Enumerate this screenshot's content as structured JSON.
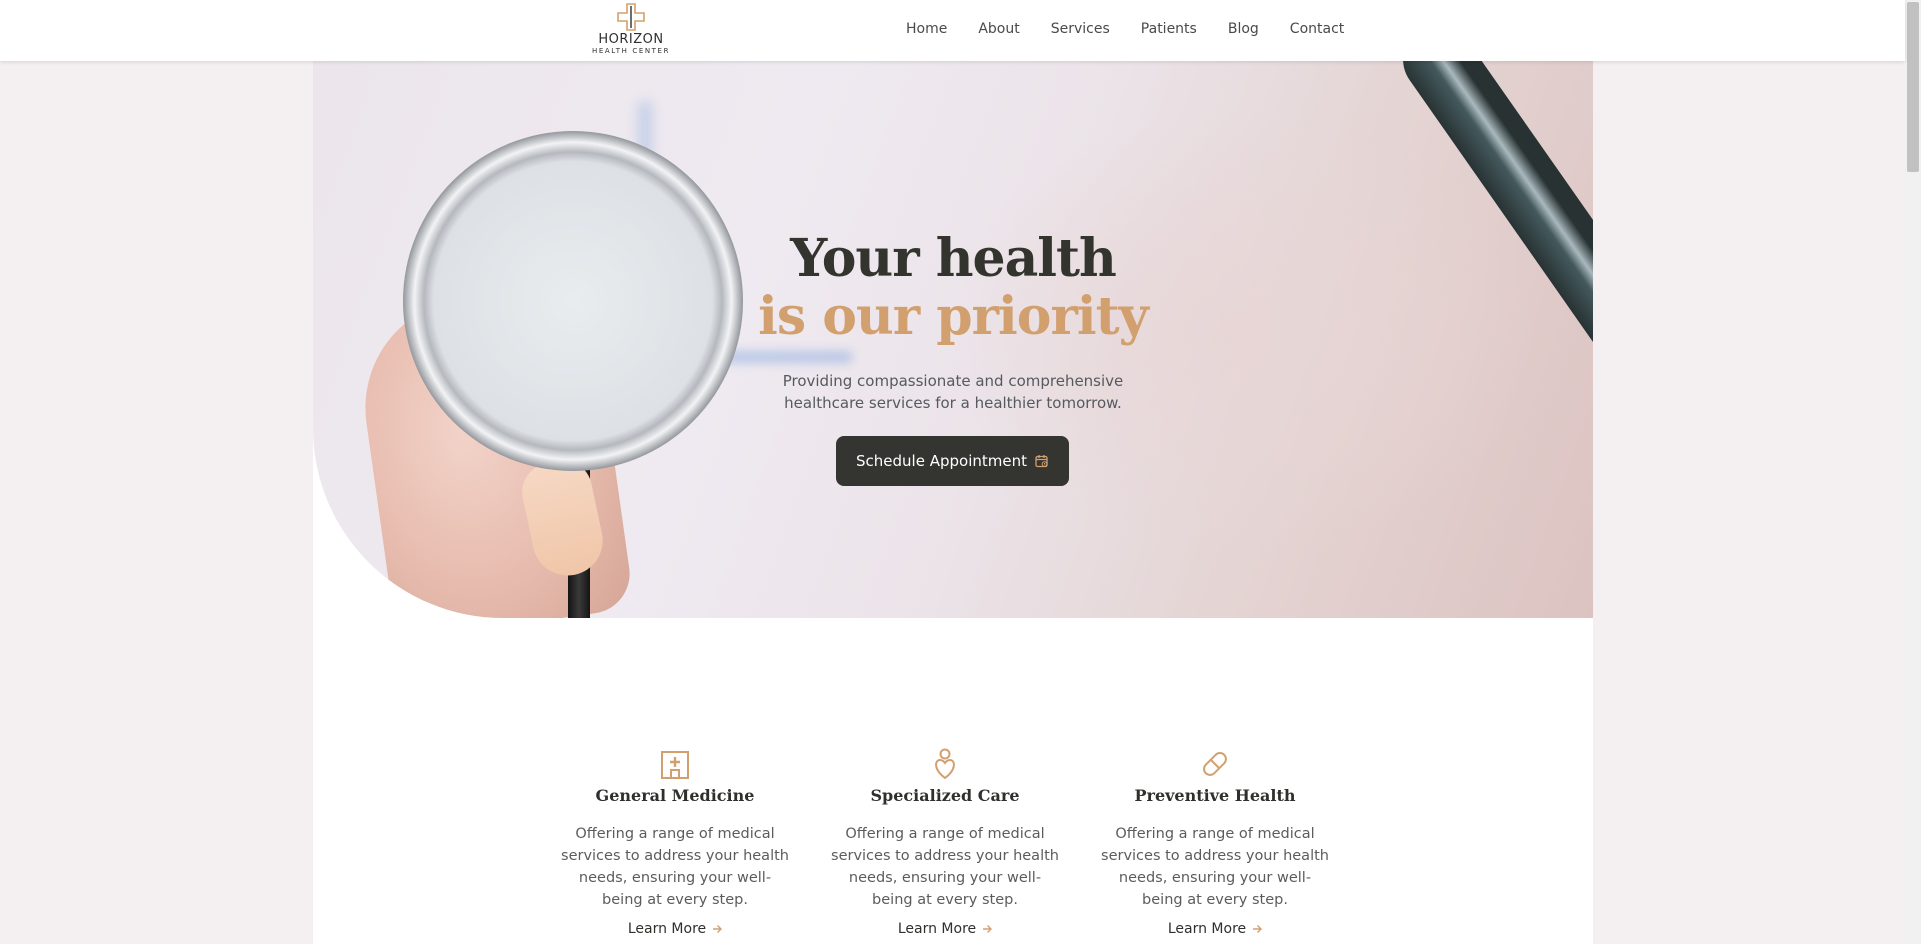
{
  "brand": {
    "name": "HORIZON",
    "subtitle": "HEALTH CENTER",
    "accent_color": "#d2a06e",
    "dark_color": "#343530"
  },
  "nav": {
    "items": [
      {
        "label": "Home"
      },
      {
        "label": "About"
      },
      {
        "label": "Services"
      },
      {
        "label": "Patients"
      },
      {
        "label": "Blog"
      },
      {
        "label": "Contact"
      }
    ]
  },
  "hero": {
    "title_line1": "Your health",
    "title_line2": "is our priority",
    "subtitle_line1": "Providing compassionate and comprehensive",
    "subtitle_line2": "healthcare services for a healthier tomorrow.",
    "cta_label": "Schedule Appointment",
    "cta_icon": "calendar-icon"
  },
  "services": [
    {
      "icon": "hospital-icon",
      "title": "General Medicine",
      "description": "Offering a range of medical services to address your health needs, ensuring your well-being at every step.",
      "link_label": "Learn More"
    },
    {
      "icon": "person-heart-icon",
      "title": "Specialized Care",
      "description": "Offering a range of medical services to address your health needs, ensuring your well-being at every step.",
      "link_label": "Learn More"
    },
    {
      "icon": "pill-icon",
      "title": "Preventive Health",
      "description": "Offering a range of medical services to address your health needs, ensuring your well-being at every step.",
      "link_label": "Learn More"
    }
  ]
}
